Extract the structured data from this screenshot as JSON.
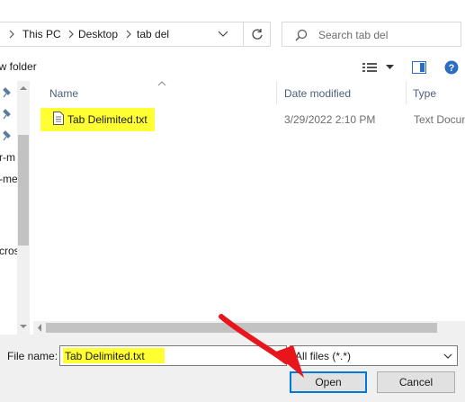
{
  "address": {
    "crumbs": [
      "This PC",
      "Desktop",
      "tab del"
    ],
    "separator": "›"
  },
  "search": {
    "placeholder": "Search tab del"
  },
  "toolbar": {
    "new_folder": "ew folder"
  },
  "nav_pane": {
    "items": [
      "r-m",
      "-me",
      "cros"
    ]
  },
  "file_list": {
    "columns": {
      "name": "Name",
      "date": "Date modified",
      "type": "Type"
    },
    "rows": [
      {
        "name": "Tab Delimited.txt",
        "date": "3/29/2022 2:10 PM",
        "type": "Text Docum"
      }
    ]
  },
  "bottom": {
    "file_name_label": "File name:",
    "file_name_value": "Tab Delimited.txt",
    "file_type": "All files (*.*)",
    "open_label": "Open",
    "cancel_label": "Cancel"
  },
  "colors": {
    "highlight": "#ffff33",
    "arrow": "#e8151c",
    "accent": "#0078d7"
  }
}
